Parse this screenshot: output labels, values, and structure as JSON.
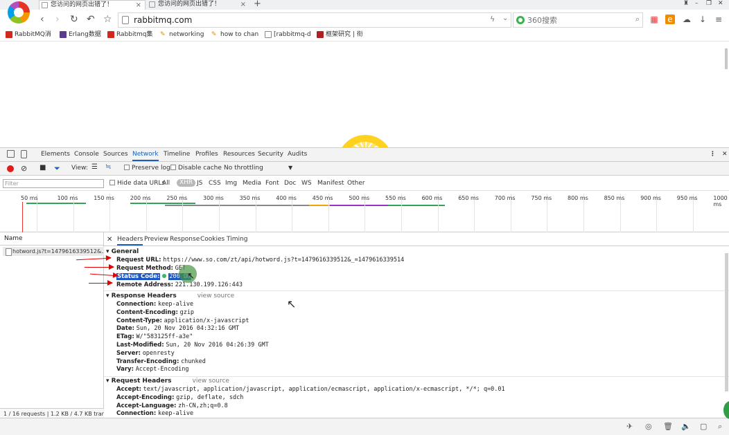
{
  "tabs": [
    {
      "title": "您访问的网页出错了！"
    },
    {
      "title": "您访问的网页出错了！"
    }
  ],
  "nav": {
    "url": "rabbitmq.com",
    "search_placeholder": "360搜索",
    "back": "‹",
    "forward": "›",
    "reload": "↻",
    "undo": "↶",
    "star": "☆"
  },
  "bookmarks": [
    {
      "label": "RabbitMQ消",
      "color": "#d4281e"
    },
    {
      "label": "Erlang数据",
      "color": "#5a3b8c"
    },
    {
      "label": "Rabbitmq集",
      "color": "#d4281e"
    },
    {
      "label": "networking",
      "color": "#e08a00"
    },
    {
      "label": "how to chan",
      "color": "#e08a00"
    },
    {
      "label": "[rabbitmq-d",
      "color": "#888888"
    },
    {
      "label": "框架研究 | 衔",
      "color": "#b02020"
    }
  ],
  "devtools": {
    "tabs": [
      "Elements",
      "Console",
      "Sources",
      "Network",
      "Timeline",
      "Profiles",
      "Resources",
      "Security",
      "Audits"
    ],
    "active_tab": "Network",
    "toolbar": {
      "view": "View:",
      "preserve_log": "Preserve log",
      "disable_cache": "Disable cache",
      "throttling": "No throttling"
    },
    "filter": {
      "placeholder": "Filter",
      "hide_data_urls": "Hide data URLs",
      "types": [
        "All",
        "XHR",
        "JS",
        "CSS",
        "Img",
        "Media",
        "Font",
        "Doc",
        "WS",
        "Manifest",
        "Other"
      ],
      "selected": "XHR"
    },
    "timeline_ticks": [
      "50 ms",
      "100 ms",
      "150 ms",
      "200 ms",
      "250 ms",
      "300 ms",
      "350 ms",
      "400 ms",
      "450 ms",
      "500 ms",
      "550 ms",
      "600 ms",
      "650 ms",
      "700 ms",
      "750 ms",
      "800 ms",
      "850 ms",
      "900 ms",
      "950 ms",
      "1000 ms"
    ],
    "request_list": {
      "header": "Name",
      "rows": [
        "hotword.js?t=1479616339512&..."
      ],
      "status": "1 / 16 requests | 1.2 KB / 4.7 KB tran..."
    },
    "detail_tabs": [
      "Headers",
      "Preview",
      "Response",
      "Cookies",
      "Timing"
    ],
    "general": {
      "title": "General",
      "request_url_k": "Request URL:",
      "request_url_v": "https://www.so.com/zt/api/hotword.js?t=1479616339512&_=1479616339514",
      "method_k": "Request Method:",
      "method_v": "GET",
      "status_k": "Status Code:",
      "status_v": "200 OK",
      "remote_k": "Remote Address:",
      "remote_v": "221.130.199.126:443"
    },
    "response_headers": {
      "title": "Response Headers",
      "view_source": "view source",
      "items": [
        [
          "Connection:",
          "keep-alive"
        ],
        [
          "Content-Encoding:",
          "gzip"
        ],
        [
          "Content-Type:",
          "application/x-javascript"
        ],
        [
          "Date:",
          "Sun, 20 Nov 2016 04:32:16 GMT"
        ],
        [
          "ETag:",
          "W/\"583125ff-a3e\""
        ],
        [
          "Last-Modified:",
          "Sun, 20 Nov 2016 04:26:39 GMT"
        ],
        [
          "Server:",
          "openresty"
        ],
        [
          "Transfer-Encoding:",
          "chunked"
        ],
        [
          "Vary:",
          "Accept-Encoding"
        ]
      ]
    },
    "request_headers": {
      "title": "Request Headers",
      "view_source": "view source",
      "items": [
        [
          "Accept:",
          "text/javascript, application/javascript, application/ecmascript, application/x-ecmascript, */*; q=0.01"
        ],
        [
          "Accept-Encoding:",
          "gzip, deflate, sdch"
        ],
        [
          "Accept-Language:",
          "zh-CN,zh;q=0.8"
        ],
        [
          "Connection:",
          "keep-alive"
        ]
      ]
    }
  }
}
